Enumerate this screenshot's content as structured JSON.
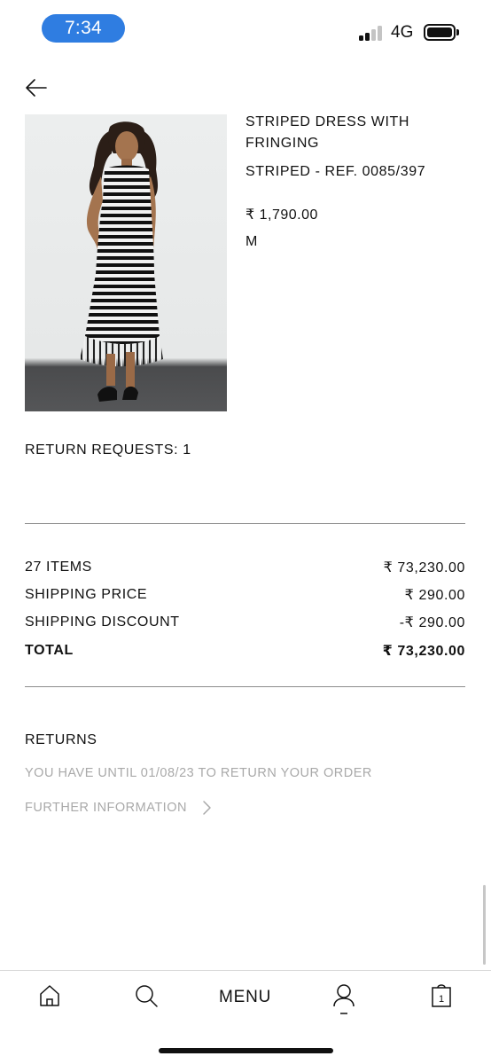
{
  "status_bar": {
    "time": "7:34",
    "network": "4G",
    "colors": {
      "time_pill": "#2f7de1"
    }
  },
  "header": {
    "back_icon": "arrow-left-icon"
  },
  "product": {
    "image_icon": "product-photo-striped-dress",
    "name": "STRIPED DRESS WITH FRINGING",
    "reference": "STRIPED - REF. 0085/397",
    "price": "₹ 1,790.00",
    "size": "M"
  },
  "return_requests": "RETURN REQUESTS: 1",
  "summary": {
    "items_label": "27 ITEMS",
    "items_value": "₹ 73,230.00",
    "shipping_label": "SHIPPING PRICE",
    "shipping_value": "₹ 290.00",
    "discount_label": "SHIPPING DISCOUNT",
    "discount_value": "-₹ 290.00",
    "total_label": "TOTAL",
    "total_value": "₹ 73,230.00"
  },
  "returns": {
    "title": "RETURNS",
    "note": "YOU HAVE UNTIL 01/08/23 TO RETURN YOUR ORDER",
    "further_info": "FURTHER INFORMATION",
    "chevron_icon": "chevron-right-icon"
  },
  "bottom_nav": {
    "home_icon": "home-icon",
    "search_icon": "search-icon",
    "menu_label": "MENU",
    "account_icon": "user-icon",
    "cart_icon": "shopping-bag-icon",
    "cart_count": "1"
  }
}
